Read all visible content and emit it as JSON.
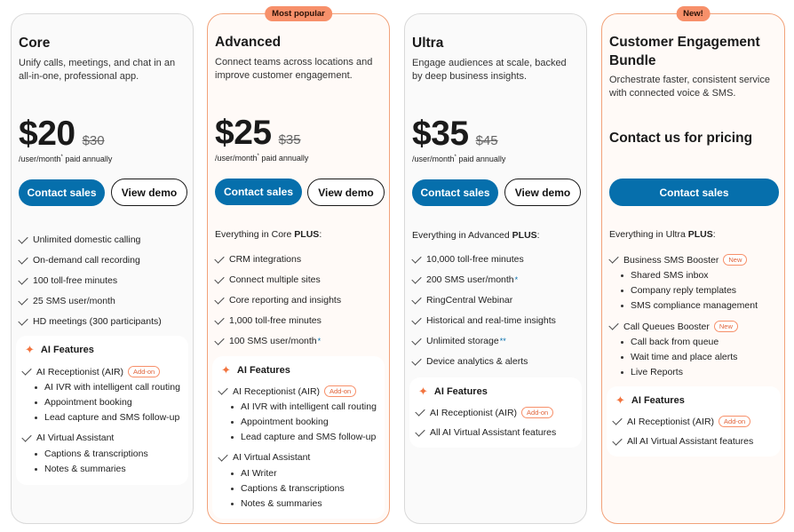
{
  "plans": [
    {
      "name": "Core",
      "description": "Unify calls, meetings, and chat in an all-in-one, professional app.",
      "price": "$20",
      "old_price": "$30",
      "per": "/user/month",
      "per_star": "*",
      "billing": "paid annually",
      "primary_button": "Contact sales",
      "secondary_button": "View demo",
      "features": [
        "Unlimited domestic calling",
        "On-demand call recording",
        "100 toll-free minutes",
        "25 SMS user/month",
        "HD meetings (300 participants)"
      ],
      "ai": {
        "heading": "AI Features",
        "items": [
          {
            "label": "AI Receptionist (AIR)",
            "badge": "Add-on"
          },
          {
            "label": "AI IVR with intelligent call routing"
          },
          {
            "label": "Appointment booking"
          },
          {
            "label": "Lead capture and SMS follow-up"
          },
          {
            "label": "AI Virtual Assistant"
          },
          {
            "label": "Captions & transcriptions"
          },
          {
            "label": "Notes & summaries"
          }
        ]
      }
    },
    {
      "name": "Advanced",
      "pill": "Most popular",
      "description": "Connect teams across locations and improve customer engagement.",
      "price": "$25",
      "old_price": "$35",
      "per": "/user/month",
      "per_star": "*",
      "billing": "paid annually",
      "primary_button": "Contact sales",
      "secondary_button": "View demo",
      "includes_prefix": "Everything in Core ",
      "includes_bold": "PLUS",
      "includes_suffix": ":",
      "features": [
        "CRM integrations",
        "Connect multiple sites",
        "Core reporting and insights",
        "1,000 toll-free minutes",
        "100 SMS user/month"
      ],
      "feature_star": "*",
      "ai": {
        "heading": "AI Features",
        "items": [
          {
            "label": "AI Receptionist (AIR)",
            "badge": "Add-on"
          },
          {
            "label": "AI IVR with intelligent call routing"
          },
          {
            "label": "Appointment booking"
          },
          {
            "label": "Lead capture and SMS follow-up"
          },
          {
            "label": "AI Virtual Assistant"
          },
          {
            "label": "AI Writer"
          },
          {
            "label": "Captions & transcriptions"
          },
          {
            "label": "Notes & summaries"
          }
        ]
      }
    },
    {
      "name": "Ultra",
      "description": "Engage audiences at scale, backed by deep business insights.",
      "price": "$35",
      "old_price": "$45",
      "per": "/user/month",
      "per_star": "*",
      "billing": "paid annually",
      "primary_button": "Contact sales",
      "secondary_button": "View demo",
      "includes_prefix": "Everything in Advanced ",
      "includes_bold": "PLUS",
      "includes_suffix": ":",
      "features": [
        "10,000 toll-free minutes",
        "200 SMS user/month",
        "RingCentral Webinar",
        "Historical and real-time insights",
        "Unlimited storage",
        "Device analytics & alerts"
      ],
      "feature_star_1": "*",
      "feature_star_4": "**",
      "ai": {
        "heading": "AI Features",
        "items": [
          {
            "label": "AI Receptionist (AIR)",
            "badge": "Add-on"
          },
          {
            "label": "All AI Virtual Assistant features"
          }
        ]
      }
    },
    {
      "name": "Customer Engagement Bundle",
      "pill": "New!",
      "description": "Orchestrate faster, consistent service with connected voice & SMS.",
      "contact_pricing": "Contact us for pricing",
      "primary_button": "Contact sales",
      "includes_prefix": "Everything in Ultra ",
      "includes_bold": "PLUS",
      "includes_suffix": ":",
      "groups": [
        {
          "label": "Business SMS Booster",
          "badge": "New",
          "items": [
            "Shared SMS inbox",
            "Company reply templates",
            "SMS compliance management"
          ]
        },
        {
          "label": "Call Queues Booster",
          "badge": "New",
          "items": [
            "Call back from queue",
            "Wait time and place alerts",
            "Live Reports"
          ]
        }
      ],
      "ai": {
        "heading": "AI Features",
        "items": [
          {
            "label": "AI Receptionist (AIR)",
            "badge": "Add-on"
          },
          {
            "label": "All AI Virtual Assistant features"
          }
        ]
      }
    }
  ],
  "colors": {
    "primary_button": "#066fac",
    "accent": "#f7906a",
    "spark": "#f2743f"
  }
}
